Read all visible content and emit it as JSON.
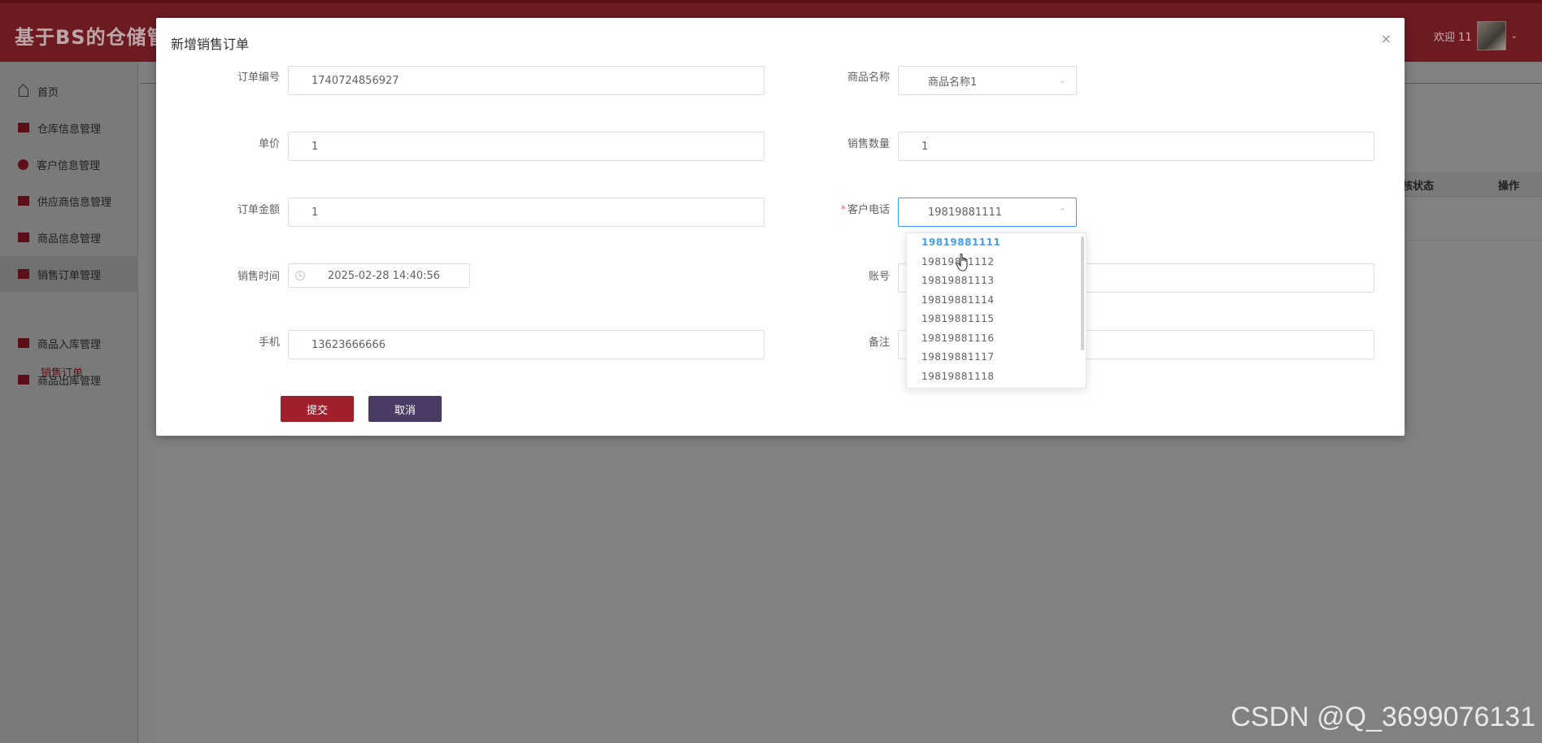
{
  "app": {
    "title": "基于BS的仓储管理",
    "welcome": "欢迎 11"
  },
  "sidebar": {
    "items": [
      {
        "label": "首页"
      },
      {
        "label": "仓库信息管理"
      },
      {
        "label": "客户信息管理"
      },
      {
        "label": "供应商信息管理"
      },
      {
        "label": "商品信息管理"
      },
      {
        "label": "销售订单管理"
      },
      {
        "label": "商品入库管理"
      },
      {
        "label": "商品出库管理"
      }
    ],
    "sub_item": "销售订单"
  },
  "table": {
    "headers": [
      "核状态",
      "操作"
    ]
  },
  "modal": {
    "title": "新增销售订单",
    "close": "×",
    "fields": {
      "order_no": {
        "label": "订单编号",
        "value": "1740724856927"
      },
      "product_name": {
        "label": "商品名称",
        "value": "商品名称1"
      },
      "unit_price": {
        "label": "单价",
        "value": "1"
      },
      "quantity": {
        "label": "销售数量",
        "value": "1"
      },
      "amount": {
        "label": "订单金额",
        "value": "1"
      },
      "customer_phone": {
        "label": "客户电话",
        "required": "*",
        "value": "19819881111"
      },
      "sale_time": {
        "label": "销售时间",
        "value": "2025-02-28 14:40:56"
      },
      "account": {
        "label": "账号",
        "value": ""
      },
      "mobile": {
        "label": "手机",
        "value": "13623666666"
      },
      "remark": {
        "label": "备注",
        "value": ""
      }
    },
    "buttons": {
      "submit": "提交",
      "cancel": "取消"
    }
  },
  "dropdown": {
    "options": [
      "19819881111",
      "19819881112",
      "19819881113",
      "19819881114",
      "19819881115",
      "19819881116",
      "19819881117",
      "19819881118"
    ],
    "selected": "19819881111"
  },
  "watermark": "CSDN @Q_3699076131",
  "colors": {
    "brand": "#a11f2a",
    "cancel": "#4a3a66",
    "selected_option": "#409eff"
  }
}
